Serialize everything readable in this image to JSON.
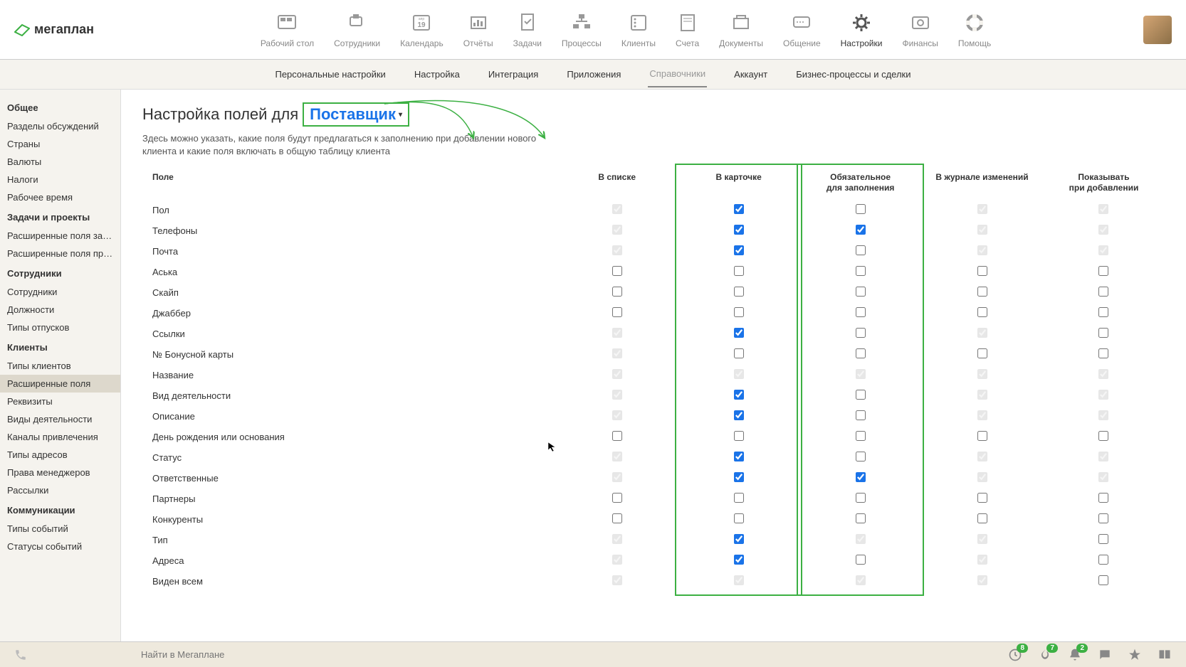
{
  "logo_text": "мегаплан",
  "topnav": [
    {
      "label": "Рабочий стол"
    },
    {
      "label": "Сотрудники"
    },
    {
      "label": "Календарь"
    },
    {
      "label": "Отчёты"
    },
    {
      "label": "Задачи"
    },
    {
      "label": "Процессы"
    },
    {
      "label": "Клиенты"
    },
    {
      "label": "Счета"
    },
    {
      "label": "Документы"
    },
    {
      "label": "Общение"
    },
    {
      "label": "Настройки"
    },
    {
      "label": "Финансы"
    },
    {
      "label": "Помощь"
    }
  ],
  "topnav_active_index": 10,
  "calendar_day": "19",
  "calendar_month": "апр",
  "subtabs": [
    "Персональные настройки",
    "Настройка",
    "Интеграция",
    "Приложения",
    "Справочники",
    "Аккаунт",
    "Бизнес-процессы и сделки"
  ],
  "subtabs_active_index": 4,
  "sidebar": [
    {
      "title": "Общее",
      "items": [
        "Разделы обсуждений",
        "Страны",
        "Валюты",
        "Налоги",
        "Рабочее время"
      ]
    },
    {
      "title": "Задачи и проекты",
      "items": [
        "Расширенные поля задач",
        "Расширенные поля проек..."
      ]
    },
    {
      "title": "Сотрудники",
      "items": [
        "Сотрудники",
        "Должности",
        "Типы отпусков"
      ]
    },
    {
      "title": "Клиенты",
      "items": [
        "Типы клиентов",
        "Расширенные поля",
        "Реквизиты",
        "Виды деятельности",
        "Каналы привлечения",
        "Типы адресов",
        "Права менеджеров",
        "Рассылки"
      ]
    },
    {
      "title": "Коммуникации",
      "items": [
        "Типы событий",
        "Статусы событий"
      ]
    }
  ],
  "sidebar_active": "Расширенные поля",
  "page": {
    "title_prefix": "Настройка полей для",
    "title_dropdown": "Поставщик",
    "description": "Здесь можно указать, какие поля будут предлагаться к заполнению при добавлении нового клиента и какие поля включать в общую таблицу клиента"
  },
  "columns": [
    "Поле",
    "В списке",
    "В карточке",
    "Обязательное для заполнения",
    "В журнале изменений",
    "Показывать при добавлении"
  ],
  "rows": [
    {
      "name": "Пол",
      "c1": {
        "v": true,
        "d": true
      },
      "c2": {
        "v": true,
        "d": false
      },
      "c3": {
        "v": false,
        "d": false
      },
      "c4": {
        "v": true,
        "d": true
      },
      "c5": {
        "v": true,
        "d": true
      }
    },
    {
      "name": "Телефоны",
      "c1": {
        "v": true,
        "d": true
      },
      "c2": {
        "v": true,
        "d": false
      },
      "c3": {
        "v": true,
        "d": false
      },
      "c4": {
        "v": true,
        "d": true
      },
      "c5": {
        "v": true,
        "d": true
      }
    },
    {
      "name": "Почта",
      "c1": {
        "v": true,
        "d": true
      },
      "c2": {
        "v": true,
        "d": false
      },
      "c3": {
        "v": false,
        "d": false
      },
      "c4": {
        "v": true,
        "d": true
      },
      "c5": {
        "v": true,
        "d": true
      }
    },
    {
      "name": "Аська",
      "c1": {
        "v": false,
        "d": false
      },
      "c2": {
        "v": false,
        "d": false
      },
      "c3": {
        "v": false,
        "d": false
      },
      "c4": {
        "v": false,
        "d": false
      },
      "c5": {
        "v": false,
        "d": false
      }
    },
    {
      "name": "Скайп",
      "c1": {
        "v": false,
        "d": false
      },
      "c2": {
        "v": false,
        "d": false
      },
      "c3": {
        "v": false,
        "d": false
      },
      "c4": {
        "v": false,
        "d": false
      },
      "c5": {
        "v": false,
        "d": false
      }
    },
    {
      "name": "Джаббер",
      "c1": {
        "v": false,
        "d": false
      },
      "c2": {
        "v": false,
        "d": false
      },
      "c3": {
        "v": false,
        "d": false
      },
      "c4": {
        "v": false,
        "d": false
      },
      "c5": {
        "v": false,
        "d": false
      }
    },
    {
      "name": "Ссылки",
      "c1": {
        "v": true,
        "d": true
      },
      "c2": {
        "v": true,
        "d": false
      },
      "c3": {
        "v": false,
        "d": false
      },
      "c4": {
        "v": true,
        "d": true
      },
      "c5": {
        "v": false,
        "d": false
      }
    },
    {
      "name": "№ Бонусной карты",
      "c1": {
        "v": true,
        "d": true
      },
      "c2": {
        "v": false,
        "d": false
      },
      "c3": {
        "v": false,
        "d": false
      },
      "c4": {
        "v": false,
        "d": false
      },
      "c5": {
        "v": false,
        "d": false
      }
    },
    {
      "name": "Название",
      "c1": {
        "v": true,
        "d": true
      },
      "c2": {
        "v": true,
        "d": true
      },
      "c3": {
        "v": true,
        "d": true
      },
      "c4": {
        "v": true,
        "d": true
      },
      "c5": {
        "v": true,
        "d": true
      }
    },
    {
      "name": "Вид деятельности",
      "c1": {
        "v": true,
        "d": true
      },
      "c2": {
        "v": true,
        "d": false
      },
      "c3": {
        "v": false,
        "d": false
      },
      "c4": {
        "v": true,
        "d": true
      },
      "c5": {
        "v": true,
        "d": true
      }
    },
    {
      "name": "Описание",
      "c1": {
        "v": true,
        "d": true
      },
      "c2": {
        "v": true,
        "d": false
      },
      "c3": {
        "v": false,
        "d": false
      },
      "c4": {
        "v": true,
        "d": true
      },
      "c5": {
        "v": true,
        "d": true
      }
    },
    {
      "name": "День рождения или основания",
      "c1": {
        "v": false,
        "d": false
      },
      "c2": {
        "v": false,
        "d": false
      },
      "c3": {
        "v": false,
        "d": false
      },
      "c4": {
        "v": false,
        "d": false
      },
      "c5": {
        "v": false,
        "d": false
      }
    },
    {
      "name": "Статус",
      "c1": {
        "v": true,
        "d": true
      },
      "c2": {
        "v": true,
        "d": false
      },
      "c3": {
        "v": false,
        "d": false
      },
      "c4": {
        "v": true,
        "d": true
      },
      "c5": {
        "v": true,
        "d": true
      }
    },
    {
      "name": "Ответственные",
      "c1": {
        "v": true,
        "d": true
      },
      "c2": {
        "v": true,
        "d": false
      },
      "c3": {
        "v": true,
        "d": false
      },
      "c4": {
        "v": true,
        "d": true
      },
      "c5": {
        "v": true,
        "d": true
      }
    },
    {
      "name": "Партнеры",
      "c1": {
        "v": false,
        "d": false
      },
      "c2": {
        "v": false,
        "d": false
      },
      "c3": {
        "v": false,
        "d": false
      },
      "c4": {
        "v": false,
        "d": false
      },
      "c5": {
        "v": false,
        "d": false
      }
    },
    {
      "name": "Конкуренты",
      "c1": {
        "v": false,
        "d": false
      },
      "c2": {
        "v": false,
        "d": false
      },
      "c3": {
        "v": false,
        "d": false
      },
      "c4": {
        "v": false,
        "d": false
      },
      "c5": {
        "v": false,
        "d": false
      }
    },
    {
      "name": "Тип",
      "c1": {
        "v": true,
        "d": true
      },
      "c2": {
        "v": true,
        "d": false
      },
      "c3": {
        "v": true,
        "d": true
      },
      "c4": {
        "v": true,
        "d": true
      },
      "c5": {
        "v": false,
        "d": false
      }
    },
    {
      "name": "Адреса",
      "c1": {
        "v": true,
        "d": true
      },
      "c2": {
        "v": true,
        "d": false
      },
      "c3": {
        "v": false,
        "d": false
      },
      "c4": {
        "v": true,
        "d": true
      },
      "c5": {
        "v": false,
        "d": false
      }
    },
    {
      "name": "Виден всем",
      "c1": {
        "v": true,
        "d": true
      },
      "c2": {
        "v": true,
        "d": true
      },
      "c3": {
        "v": true,
        "d": true
      },
      "c4": {
        "v": true,
        "d": true
      },
      "c5": {
        "v": false,
        "d": false
      }
    }
  ],
  "footer": {
    "search_placeholder": "Найти в Мегаплане",
    "badges": {
      "clock": "8",
      "fire": "7",
      "bell": "2"
    }
  }
}
